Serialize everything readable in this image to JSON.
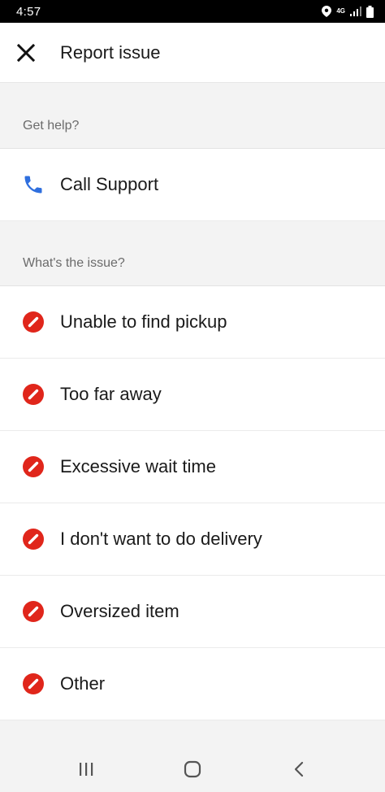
{
  "status_bar": {
    "time": "4:57",
    "network": "4G",
    "icons": [
      "location-icon",
      "signal-icon",
      "battery-icon"
    ]
  },
  "header": {
    "title": "Report issue",
    "close_icon": "close-icon"
  },
  "help_section": {
    "heading": "Get help?",
    "call_label": "Call Support",
    "call_icon": "phone-icon"
  },
  "issue_section": {
    "heading": "What's the issue?",
    "items": [
      {
        "label": "Unable to find pickup",
        "icon": "prohibited-icon"
      },
      {
        "label": "Too far away",
        "icon": "prohibited-icon"
      },
      {
        "label": "Excessive wait time",
        "icon": "prohibited-icon"
      },
      {
        "label": "I don't want to do delivery",
        "icon": "prohibited-icon"
      },
      {
        "label": "Oversized item",
        "icon": "prohibited-icon"
      },
      {
        "label": "Other",
        "icon": "prohibited-icon"
      }
    ]
  },
  "nav_bar": {
    "buttons": [
      "recent-apps-icon",
      "home-icon",
      "back-icon"
    ]
  },
  "colors": {
    "issue_icon": "#e0261b",
    "phone_icon": "#2f6fde",
    "section_bg": "#f3f3f3",
    "status_bar": "#000000"
  }
}
